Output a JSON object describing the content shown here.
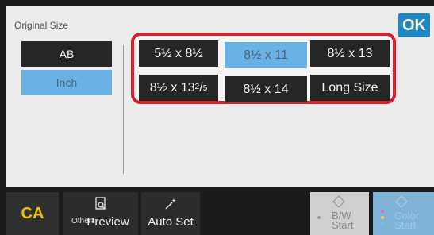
{
  "panel": {
    "title": "Original Size",
    "ok_label": "OK"
  },
  "units": {
    "ab_label": "AB",
    "inch_label": "Inch",
    "selected": "Inch"
  },
  "sizes": {
    "s1": "5½ x 8½",
    "s2": "8½ x 11",
    "s3": "8½ x 13",
    "s4_main": "8½ x 13",
    "s4_sup": "2",
    "s4_slash": "/",
    "s4_sub": "5",
    "s5": "8½ x 14",
    "s6": "Long Size",
    "selected": "8½ x 11"
  },
  "bottom": {
    "ca_label": "CA",
    "others_label": "Others",
    "preview_label": "Preview",
    "autoset_label": "Auto Set",
    "bw_line1": "B/W",
    "bw_line2": "Start",
    "color_line1": "Color",
    "color_line2": "Start"
  },
  "colors": {
    "accent": "#1e87c6",
    "selected": "#6ab2e6",
    "highlight_frame": "#d91e2e",
    "ca_text": "#f2c200"
  }
}
